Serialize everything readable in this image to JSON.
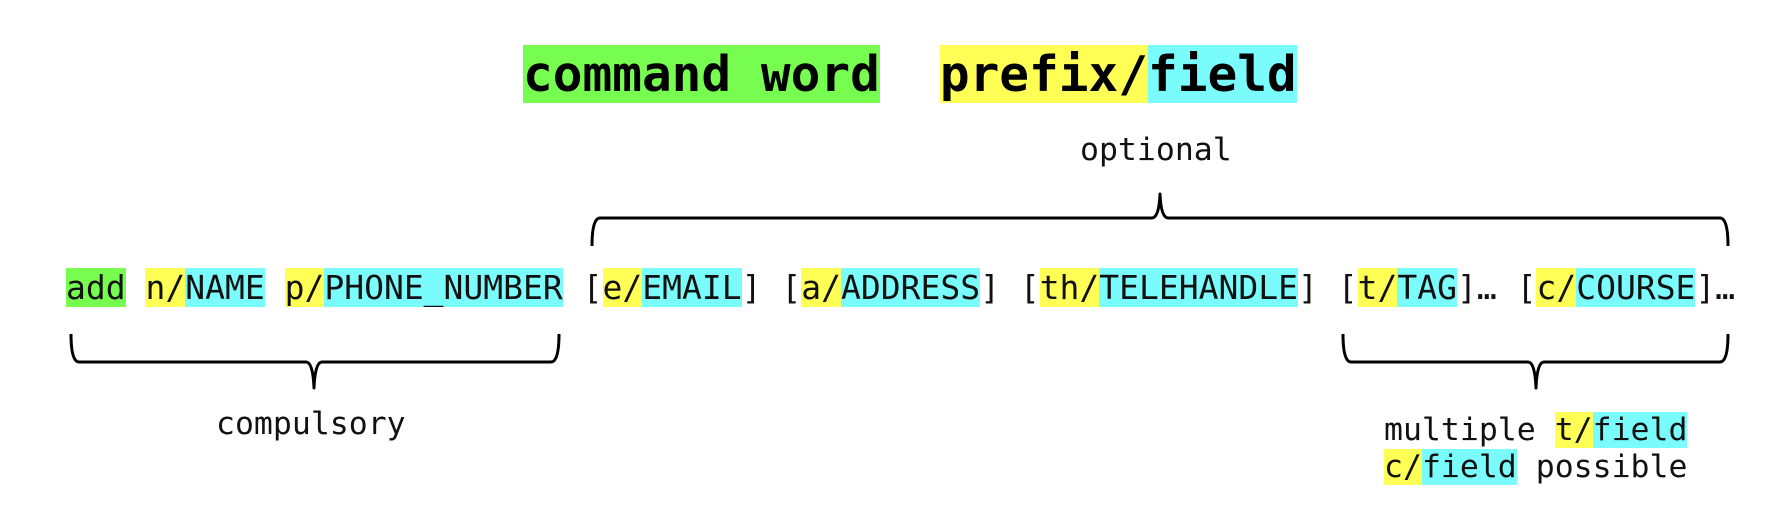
{
  "legend": {
    "command_word": "command word",
    "prefix": "prefix/",
    "field": "field"
  },
  "colors": {
    "command_word": "#77fd50",
    "prefix": "#ffff55",
    "field": "#7afcfd"
  },
  "labels": {
    "optional": "optional",
    "compulsory": "compulsory",
    "multiple_line1_text": "multiple ",
    "multiple_line1_prefix": "t/",
    "multiple_line1_field": "field",
    "multiple_line2_prefix": "c/",
    "multiple_line2_field": "field",
    "multiple_line2_text": " possible"
  },
  "command": {
    "word": "add",
    "params": [
      {
        "open": "",
        "prefix": "n/",
        "field": "NAME",
        "close": "",
        "optional": false
      },
      {
        "open": "",
        "prefix": "p/",
        "field": "PHONE_NUMBER",
        "close": "",
        "optional": false
      },
      {
        "open": "[",
        "prefix": "e/",
        "field": "EMAIL",
        "close": "]",
        "optional": true
      },
      {
        "open": "[",
        "prefix": "a/",
        "field": "ADDRESS",
        "close": "]",
        "optional": true
      },
      {
        "open": "[",
        "prefix": "th/",
        "field": "TELEHANDLE",
        "close": "]",
        "optional": true
      },
      {
        "open": "[",
        "prefix": "t/",
        "field": "TAG",
        "close": "]…",
        "optional": true
      },
      {
        "open": "[",
        "prefix": "c/",
        "field": "COURSE",
        "close": "]…",
        "optional": true
      }
    ]
  }
}
